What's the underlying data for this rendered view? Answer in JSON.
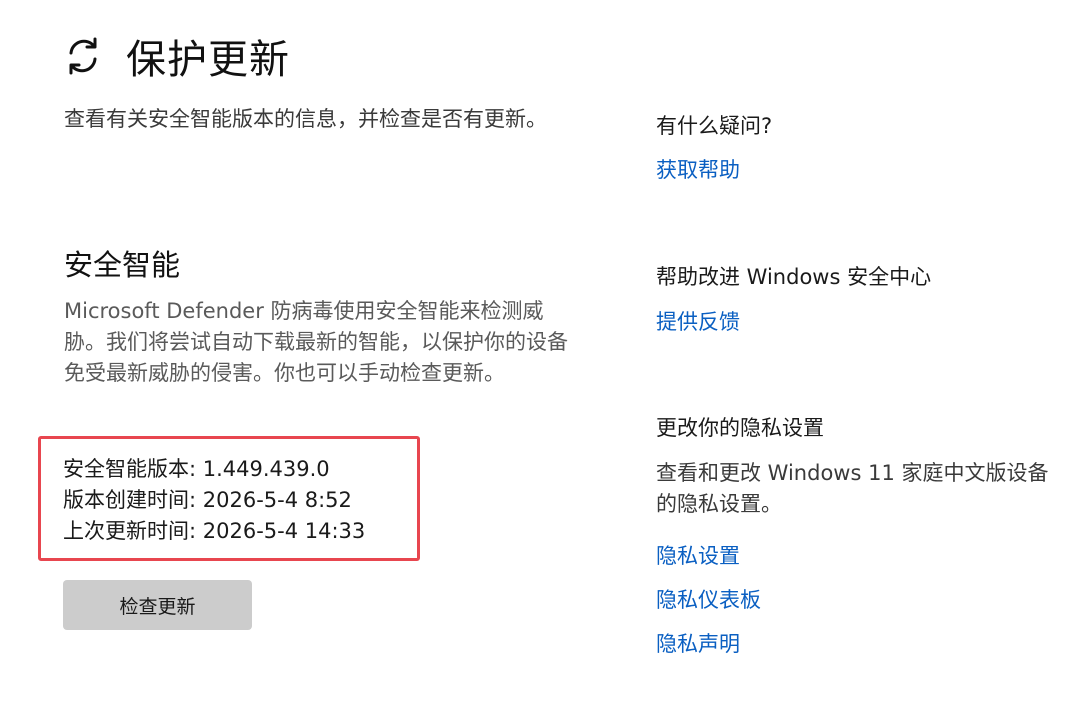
{
  "header": {
    "title": "保护更新",
    "icon": "refresh-icon"
  },
  "intro": {
    "text": "查看有关安全智能版本的信息，并检查是否有更新。"
  },
  "security_intelligence": {
    "title": "安全智能",
    "description": "Microsoft Defender 防病毒使用安全智能来检测威胁。我们将尝试自动下载最新的智能，以保护你的设备免受最新威胁的侵害。你也可以手动检查更新。",
    "version_line": "安全智能版本: 1.449.439.0",
    "created_line": "版本创建时间: 2026-5-4 8:52",
    "updated_line": "上次更新时间: 2026-5-4 14:33",
    "check_button_label": "检查更新",
    "highlight_color": "#e8464f"
  },
  "sidebar": {
    "questions": {
      "heading": "有什么疑问?",
      "link": "获取帮助"
    },
    "feedback": {
      "heading": "帮助改进 Windows 安全中心",
      "link": "提供反馈"
    },
    "privacy": {
      "heading": "更改你的隐私设置",
      "description": "查看和更改 Windows 11 家庭中文版设备的隐私设置。",
      "links": [
        "隐私设置",
        "隐私仪表板",
        "隐私声明"
      ]
    }
  },
  "colors": {
    "link": "#0a5fc2",
    "button_bg": "#cccccc"
  }
}
